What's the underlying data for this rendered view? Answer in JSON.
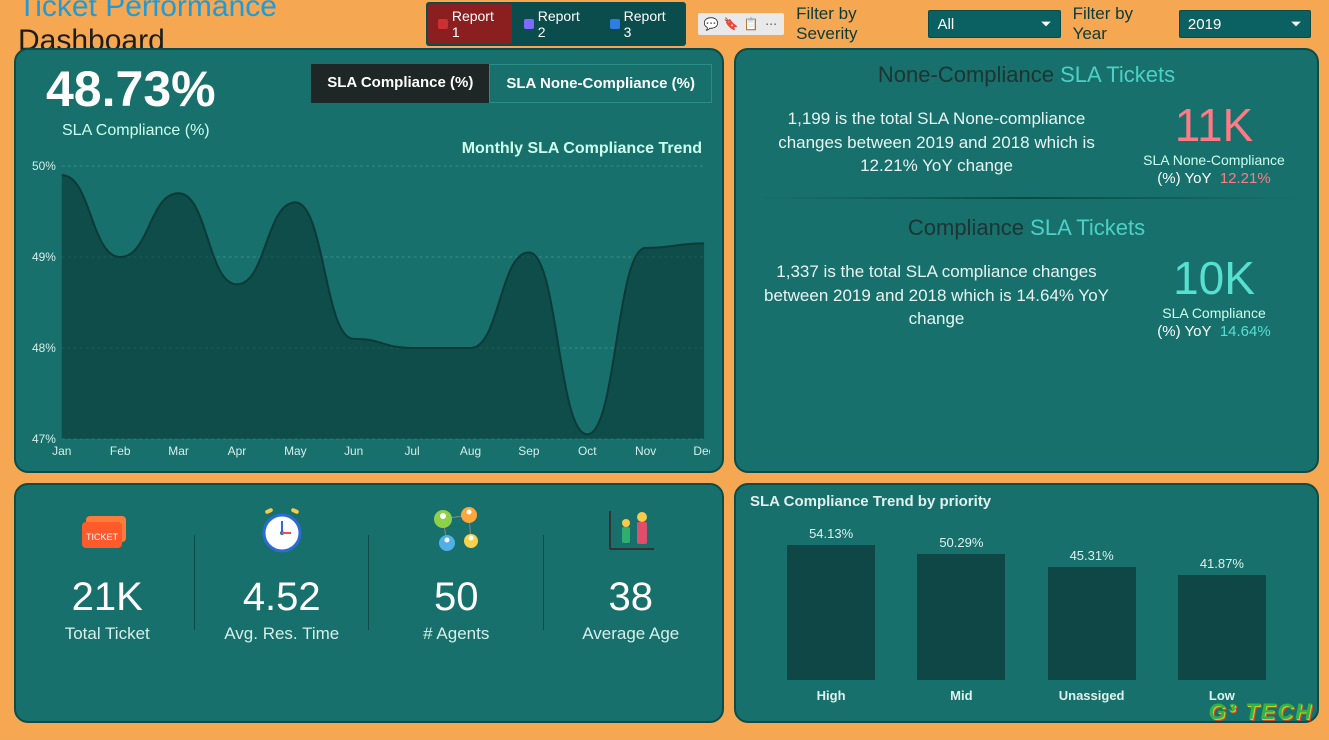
{
  "header": {
    "title_accent": "Ticket Performance",
    "title_rest": " Dashboard",
    "reports": [
      "Report 1",
      "Report 2",
      "Report 3"
    ],
    "active_report": 0,
    "filter_severity_label": "Filter by Severity",
    "filter_severity_value": "All",
    "filter_year_label": "Filter by Year",
    "filter_year_value": "2019"
  },
  "sla_card": {
    "big_value": "48.73%",
    "big_label": "SLA Compliance (%)",
    "tab1": "SLA Compliance (%)",
    "tab2": "SLA None-Compliance (%)",
    "chart_title": "Monthly SLA Compliance Trend"
  },
  "nc": {
    "heading_pre": "None-Compliance ",
    "heading_hl": "SLA Tickets",
    "desc": "1,199 is the total SLA None-compliance changes between 2019 and 2018 which is 12.21% YoY change",
    "value": "11K",
    "label": "SLA None-Compliance",
    "yoy_label": "(%) YoY",
    "yoy_value": "12.21%"
  },
  "c": {
    "heading_pre": "Compliance ",
    "heading_hl": "SLA Tickets",
    "desc": "1,337 is the total SLA compliance changes between 2019 and 2018 which is 14.64% YoY change",
    "value": "10K",
    "label": "SLA Compliance",
    "yoy_label": "(%) YoY",
    "yoy_value": "14.64%"
  },
  "kpis": [
    {
      "value": "21K",
      "label": "Total Ticket",
      "icon": "ticket"
    },
    {
      "value": "4.52",
      "label": "Avg. Res. Time",
      "icon": "clock"
    },
    {
      "value": "50",
      "label": "# Agents",
      "icon": "network"
    },
    {
      "value": "38",
      "label": "Average Age",
      "icon": "people"
    }
  ],
  "priority": {
    "title": "SLA Compliance Trend by priority"
  },
  "logo": "G³ TECH",
  "chart_data": [
    {
      "type": "line",
      "title": "Monthly SLA Compliance Trend",
      "xlabel": "",
      "ylabel": "",
      "ylim": [
        47,
        50
      ],
      "categories": [
        "Jan",
        "Feb",
        "Mar",
        "Apr",
        "May",
        "Jun",
        "Jul",
        "Aug",
        "Sep",
        "Oct",
        "Nov",
        "Dec"
      ],
      "series": [
        {
          "name": "SLA Compliance (%)",
          "values": [
            49.9,
            49.0,
            49.7,
            48.7,
            49.6,
            48.1,
            48.0,
            48.0,
            49.05,
            47.05,
            49.1,
            49.15
          ]
        }
      ]
    },
    {
      "type": "bar",
      "title": "SLA Compliance Trend by priority",
      "xlabel": "",
      "ylabel": "",
      "ylim": [
        0,
        60
      ],
      "categories": [
        "High",
        "Mid",
        "Unassiged",
        "Low"
      ],
      "values": [
        54.13,
        50.29,
        45.31,
        41.87
      ]
    }
  ]
}
